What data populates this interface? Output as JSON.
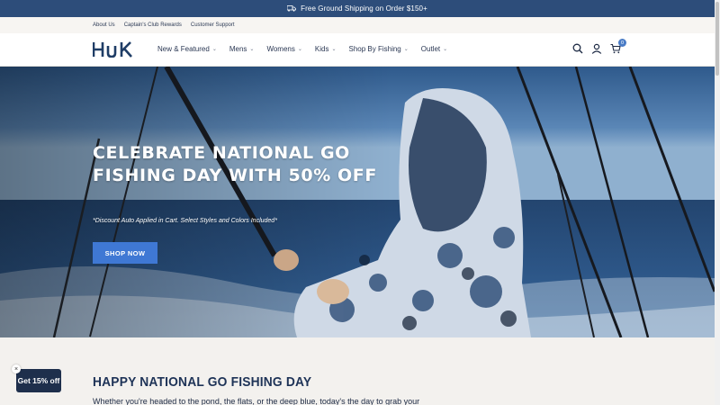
{
  "promo": {
    "text": "Free Ground Shipping on Order $150+",
    "icon": "truck-icon"
  },
  "utility_links": [
    "About Us",
    "Captain's Club Rewards",
    "Customer Support"
  ],
  "brand": {
    "logo_text": "HUK",
    "color": "#1f3d66"
  },
  "nav": {
    "items": [
      {
        "label": "New & Featured"
      },
      {
        "label": "Mens"
      },
      {
        "label": "Womens"
      },
      {
        "label": "Kids"
      },
      {
        "label": "Shop By Fishing"
      },
      {
        "label": "Outlet"
      }
    ],
    "icons": [
      "search-icon",
      "account-icon",
      "cart-icon"
    ],
    "cart_count": "0"
  },
  "hero": {
    "title": "CELEBRATE NATIONAL GO FISHING DAY WITH 50% OFF",
    "subtitle": "*Discount Auto Applied in Cart. Select Styles and Colors Included*",
    "cta": "SHOP NOW"
  },
  "section": {
    "heading": "HAPPY NATIONAL GO FISHING DAY",
    "body": "Whether you're headed to the pond, the flats, or the deep blue, today's the day to grab your"
  },
  "discount_tab": {
    "label": "Get 15% off",
    "close": "×"
  },
  "colors": {
    "promo_bg": "#2d4d7a",
    "cta": "#3f78d4",
    "heading": "#1e3357"
  }
}
